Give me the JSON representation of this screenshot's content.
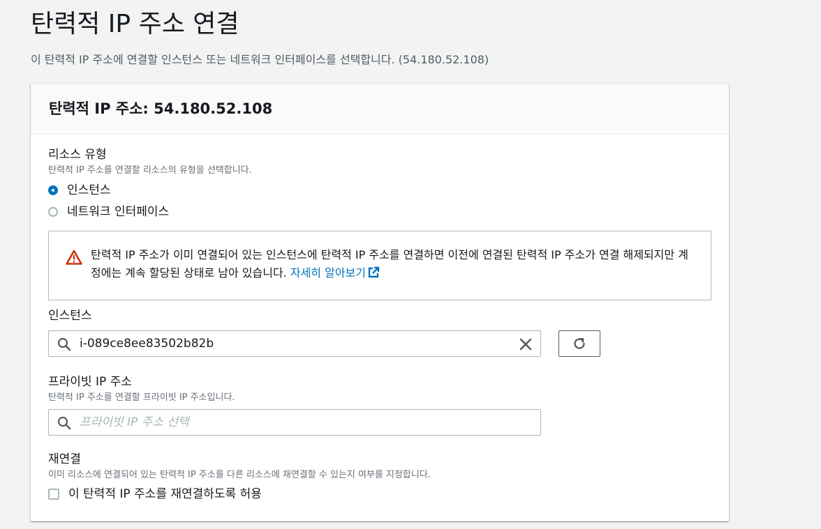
{
  "page": {
    "title": "탄력적 IP 주소 연결",
    "description": "이 탄력적 IP 주소에 연결할 인스턴스 또는 네트워크 인터페이스를 선택합니다. (54.180.52.108)"
  },
  "panel": {
    "header": "탄력적 IP 주소: 54.180.52.108"
  },
  "resource_type": {
    "label": "리소스 유형",
    "hint": "탄력적 IP 주소를 연결할 리소스의 유형을 선택합니다.",
    "options": [
      {
        "label": "인스턴스",
        "selected": true
      },
      {
        "label": "네트워크 인터페이스",
        "selected": false
      }
    ]
  },
  "alert": {
    "icon": "warning-icon",
    "text": "탄력적 IP 주소가 이미 연결되어 있는 인스턴스에 탄력적 IP 주소를 연결하면 이전에 연결된 탄력적 IP 주소가 연결 해제되지만 계정에는 계속 할당된 상태로 남아 있습니다.",
    "link": "자세히 알아보기"
  },
  "instance": {
    "label": "인스턴스",
    "value": "i-089ce8ee83502b82b"
  },
  "private_ip": {
    "label": "프라이빗 IP 주소",
    "hint": "탄력적 IP 주소를 연결할 프라이빗 IP 주소입니다.",
    "placeholder": "프라이빗 IP 주소 선택"
  },
  "reassociation": {
    "label": "재연결",
    "hint": "이미 리소스에 연결되어 있는 탄력적 IP 주소를 다른 리소스에 재연결할 수 있는지 여부를 지정합니다.",
    "checkbox_label": "이 탄력적 IP 주소를 재연결하도록 허용",
    "checked": false
  },
  "colors": {
    "accent": "#0073bb",
    "warning": "#d13212",
    "border": "#aab7b8"
  }
}
